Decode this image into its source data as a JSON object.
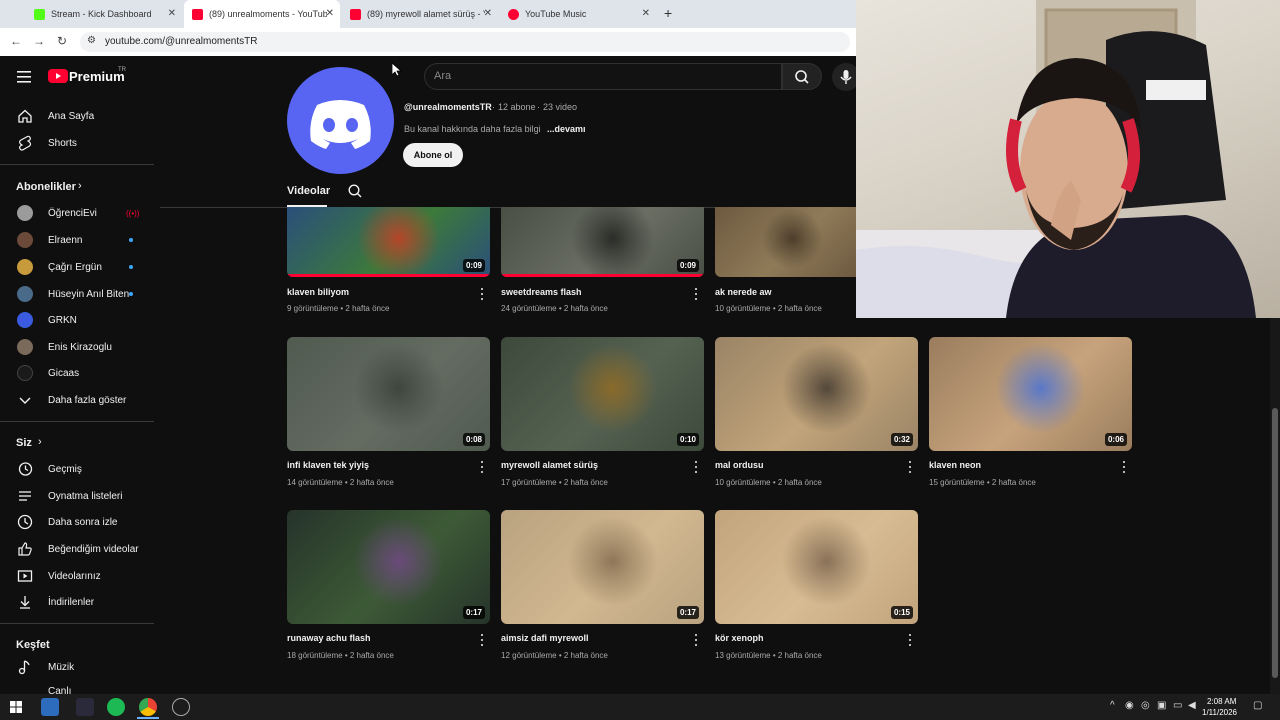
{
  "browser": {
    "tabs": [
      {
        "title": "Stream - Kick Dashboard",
        "favicon_color": "#53fc18"
      },
      {
        "title": "(89) unrealmoments - YouTube",
        "favicon_color": "#ff0033"
      },
      {
        "title": "(89) myrewoll alamet sürüş - Yo",
        "favicon_color": "#ff0033"
      },
      {
        "title": "YouTube Music",
        "favicon_color": "#ff0033"
      }
    ],
    "url": "youtube.com/@unrealmomentsTR"
  },
  "header": {
    "logo_text": "Premium",
    "region": "TR",
    "search_placeholder": "Ara"
  },
  "sidebar": {
    "main": [
      {
        "label": "Ana Sayfa",
        "icon": "home-icon"
      },
      {
        "label": "Shorts",
        "icon": "shorts-icon"
      }
    ],
    "subscriptions_title": "Abonelikler",
    "subscriptions": [
      {
        "label": "ÖğrenciEvi",
        "color": "#9b9b9b",
        "badge": "live"
      },
      {
        "label": "Elraenn",
        "color": "#6b4a3a",
        "badge": "dot"
      },
      {
        "label": "Çağrı Ergün",
        "color": "#c79a3c",
        "badge": "dot"
      },
      {
        "label": "Hüseyin Anıl Biten",
        "color": "#4a6a8a",
        "badge": "dot"
      },
      {
        "label": "GRKN",
        "color": "#3a5adf",
        "badge": ""
      },
      {
        "label": "Enis Kirazoglu",
        "color": "#7a6a5a",
        "badge": ""
      },
      {
        "label": "Gicaas",
        "color": "#1a1a1a",
        "badge": ""
      }
    ],
    "show_more": "Daha fazla göster",
    "you_title": "Siz",
    "you_items": [
      {
        "label": "Geçmiş",
        "icon": "history-icon"
      },
      {
        "label": "Oynatma listeleri",
        "icon": "playlists-icon"
      },
      {
        "label": "Daha sonra izle",
        "icon": "watch-later-icon"
      },
      {
        "label": "Beğendiğim videolar",
        "icon": "liked-icon"
      },
      {
        "label": "Videolarınız",
        "icon": "your-videos-icon"
      },
      {
        "label": "İndirilenler",
        "icon": "downloads-icon"
      }
    ],
    "explore_title": "Keşfet",
    "explore_items": [
      {
        "label": "Müzik",
        "icon": "music-icon"
      },
      {
        "label": "Canlı",
        "icon": "live-icon"
      }
    ]
  },
  "channel": {
    "handle": "@unrealmomentsTR",
    "subscribers": "12 abone",
    "video_count": "23 video",
    "about": "Bu kanal hakkında daha fazla bilgi",
    "more": "...devamı",
    "subscribe": "Abone ol",
    "tab": "Videolar"
  },
  "videos": [
    {
      "title": "klaven biliyom",
      "views": "9 görüntüleme",
      "age": "2 hafta önce",
      "duration": "0:09",
      "colors": [
        "#2b4f7a",
        "#3c7a3a",
        "#b5462b"
      ],
      "progress": 1.0
    },
    {
      "title": "sweetdreams flash",
      "views": "24 görüntüleme",
      "age": "2 hafta önce",
      "duration": "0:09",
      "colors": [
        "#4a4f46",
        "#6a6e63",
        "#2a2d28"
      ],
      "progress": 1.0
    },
    {
      "title": "ak nerede aw",
      "views": "10 görüntüleme",
      "age": "2 hafta önce",
      "duration": "",
      "colors": [
        "#6d5a3f",
        "#8f7a58",
        "#4c3e2b"
      ],
      "progress": 0
    },
    {
      "title": "infi klaven tek yiyiş",
      "views": "14 görüntüleme",
      "age": "2 hafta önce",
      "duration": "0:08",
      "colors": [
        "#505a4f",
        "#646c62",
        "#3f463e"
      ],
      "progress": 0
    },
    {
      "title": "myrewoll alamet sürüş",
      "views": "17 görüntüleme",
      "age": "2 hafta önce",
      "duration": "0:10",
      "colors": [
        "#3d4a3b",
        "#556252",
        "#8a6a2a"
      ],
      "progress": 0
    },
    {
      "title": "mal ordusu",
      "views": "10 görüntüleme",
      "age": "2 hafta önce",
      "duration": "0:32",
      "colors": [
        "#9a8466",
        "#c1a47a",
        "#54483a"
      ],
      "progress": 0
    },
    {
      "title": "klaven neon",
      "views": "15 görüntüleme",
      "age": "2 hafta önce",
      "duration": "0:06",
      "colors": [
        "#9a7d5e",
        "#c7a37c",
        "#5a78c8"
      ],
      "progress": 0
    },
    {
      "title": "runaway achu flash",
      "views": "18 görüntüleme",
      "age": "2 hafta önce",
      "duration": "0:17",
      "colors": [
        "#26332a",
        "#3d5a36",
        "#6a4a7a"
      ],
      "progress": 0
    },
    {
      "title": "aimsiz dafi myrewoll",
      "views": "12 görüntüleme",
      "age": "2 hafta önce",
      "duration": "0:17",
      "colors": [
        "#b9a27f",
        "#d1b891",
        "#8f7658"
      ],
      "progress": 0
    },
    {
      "title": "kör xenoph",
      "views": "13 görüntüleme",
      "age": "2 hafta önce",
      "duration": "0:15",
      "colors": [
        "#c2a47c",
        "#d7bc93",
        "#8a7258"
      ],
      "progress": 0
    }
  ],
  "taskbar": {
    "time": "2:08 AM",
    "date": "1/11/2026"
  }
}
